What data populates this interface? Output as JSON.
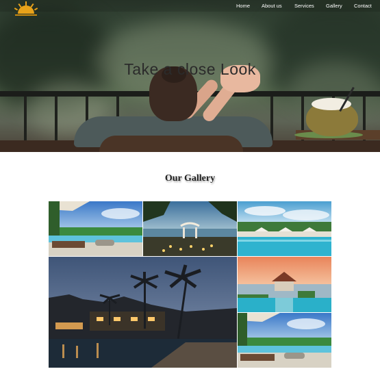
{
  "nav": {
    "home": "Home",
    "about": "About us",
    "services": "Services",
    "gallery": "Gallery",
    "contact": "Contact"
  },
  "hero": {
    "title": "Take a close Look"
  },
  "gallery": {
    "title": "Our Gallery",
    "images": [
      "resort-pool-umbrellas-icon",
      "beach-sunset-dinner-icon",
      "infinity-pool-cabanas-icon",
      "resort-palms-night-icon",
      "overwater-gazebo-sunset-icon",
      "resort-pool-loungers-icon"
    ]
  },
  "colors": {
    "nav_text": "#ffffff",
    "logo": "#e8a21a"
  }
}
